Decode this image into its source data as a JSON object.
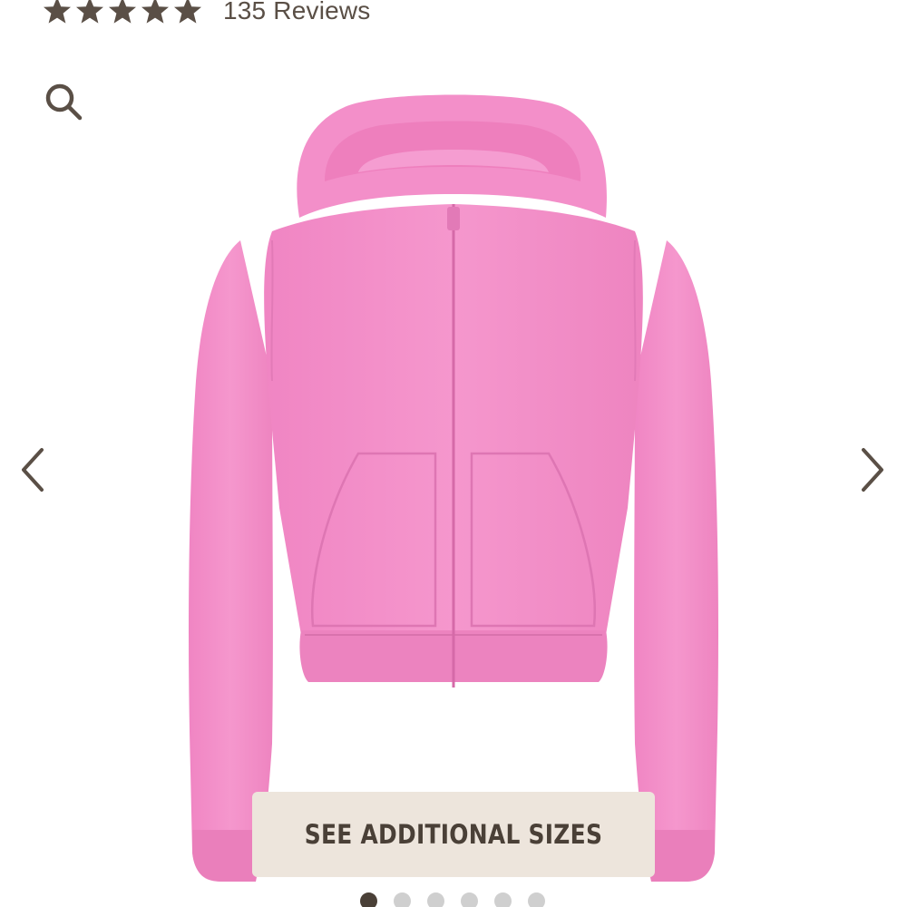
{
  "rating": {
    "stars": 5,
    "reviews_text": "135 Reviews"
  },
  "gallery": {
    "image_subject": "pink cropped zip-up hoodie",
    "product_color": "#f48ec8",
    "slide_count": 6,
    "active_slide": 1
  },
  "sizes_button": {
    "label": "SEE ADDITIONAL SIZES"
  },
  "icons": {
    "zoom": "magnifier-icon",
    "prev": "chevron-left-icon",
    "next": "chevron-right-icon",
    "star": "star-icon"
  },
  "colors": {
    "icon": "#5a4f46",
    "button_bg": "#ede5dc",
    "button_text": "#4a4037",
    "dot_active": "#4a4037",
    "dot_inactive": "#cfcfcf"
  }
}
